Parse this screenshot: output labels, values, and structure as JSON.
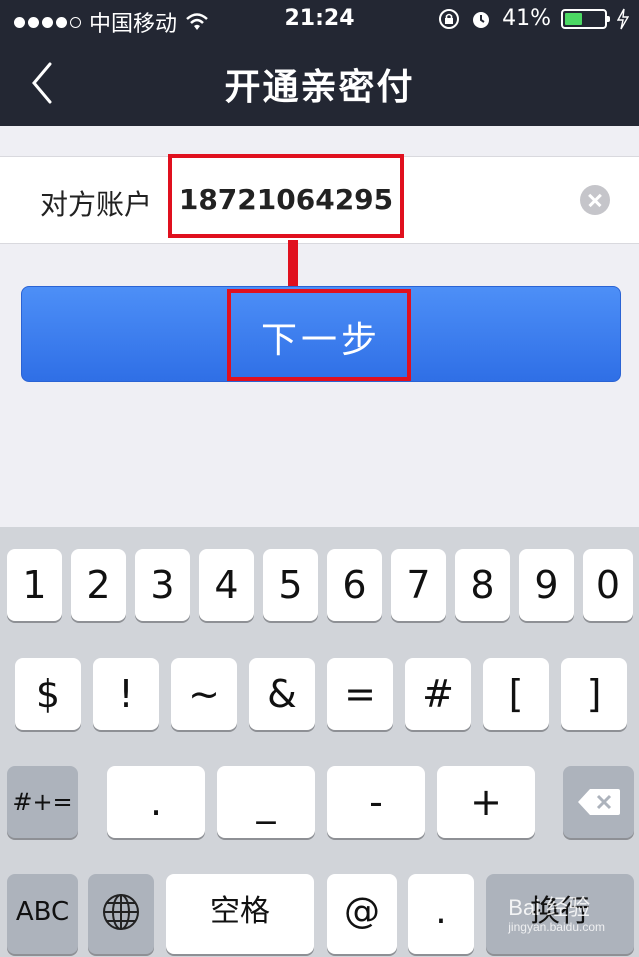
{
  "status": {
    "carrier": "中国移动",
    "time": "21:24",
    "battery": "41%",
    "battery_level": 0.41,
    "signal_bars_filled": 4,
    "signal_bars_total": 5
  },
  "nav": {
    "title": "开通亲密付"
  },
  "account": {
    "label": "对方账户",
    "value": "18721064295"
  },
  "actions": {
    "next_label": "下一步"
  },
  "keyboard": {
    "row1": [
      "1",
      "2",
      "3",
      "4",
      "5",
      "6",
      "7",
      "8",
      "9",
      "0"
    ],
    "row2": [
      "$",
      "!",
      "~",
      "&",
      "=",
      "#",
      "[",
      "]"
    ],
    "row3": [
      "#+=",
      ".",
      "_",
      "-",
      "+"
    ],
    "row4": [
      "ABC",
      "空格",
      "@",
      ".",
      "换行"
    ]
  },
  "watermark": {
    "brand": "Bai 经验",
    "url": "jingyan.baidu.com"
  },
  "colors": {
    "nav_bg": "#232733",
    "button_blue": "#3b7cf0",
    "highlight_red": "#e0101e",
    "battery_green": "#4cd964"
  }
}
